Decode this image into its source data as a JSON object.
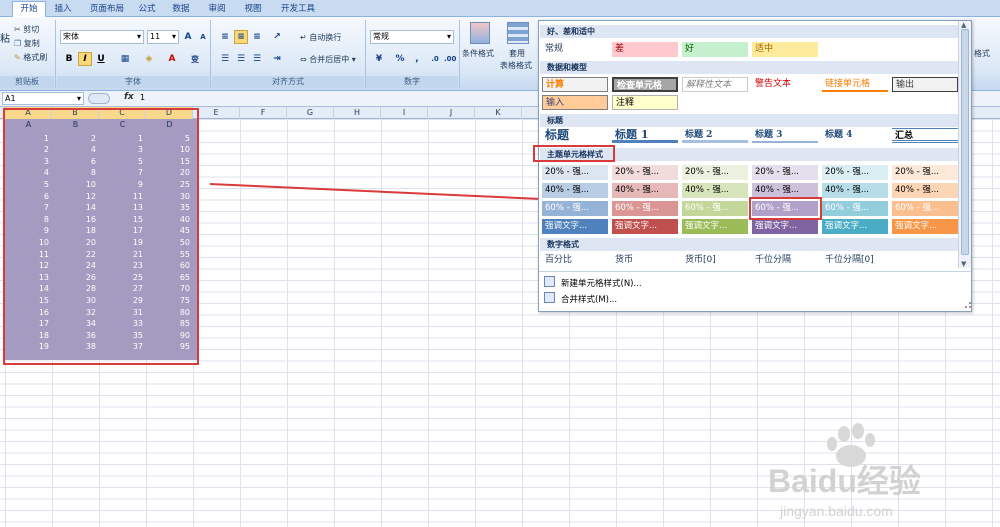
{
  "tabs": [
    "开始",
    "插入",
    "页面布局",
    "公式",
    "数据",
    "审阅",
    "视图",
    "开发工具"
  ],
  "clipboard": {
    "paste": "粘",
    "cut": "剪切",
    "copy": "复制",
    "format_painter": "格式刷",
    "label": "剪贴板"
  },
  "font": {
    "name": "宋体",
    "size": "11",
    "bold": "B",
    "italic": "I",
    "underline": "U",
    "label": "字体",
    "grow": "A",
    "shrink": "A",
    "char_a": "A",
    "wen": "变"
  },
  "alignment": {
    "wrap": "自动换行",
    "merge": "合并后居中",
    "label": "对齐方式"
  },
  "number": {
    "format": "常规",
    "percent": "%",
    "comma": ",",
    "label": "数字"
  },
  "styles": {
    "cond": "条件格式",
    "table": "套用",
    "table2": "表格格式"
  },
  "right_edge": {
    "label": "格式"
  },
  "formula_bar": {
    "cell_ref": "A1",
    "fx": "fx",
    "value": "1"
  },
  "columns": [
    "A",
    "B",
    "C",
    "D",
    "E",
    "F",
    "G",
    "H",
    "I",
    "J",
    "K"
  ],
  "table_rows": [
    [
      "1",
      "2",
      "1",
      "5"
    ],
    [
      "2",
      "4",
      "3",
      "10"
    ],
    [
      "3",
      "6",
      "5",
      "15"
    ],
    [
      "4",
      "8",
      "7",
      "20"
    ],
    [
      "5",
      "10",
      "9",
      "25"
    ],
    [
      "6",
      "12",
      "11",
      "30"
    ],
    [
      "7",
      "14",
      "13",
      "35"
    ],
    [
      "8",
      "16",
      "15",
      "40"
    ],
    [
      "9",
      "18",
      "17",
      "45"
    ],
    [
      "10",
      "20",
      "19",
      "50"
    ],
    [
      "11",
      "22",
      "21",
      "55"
    ],
    [
      "12",
      "24",
      "23",
      "60"
    ],
    [
      "13",
      "26",
      "25",
      "65"
    ],
    [
      "14",
      "28",
      "27",
      "70"
    ],
    [
      "15",
      "30",
      "29",
      "75"
    ],
    [
      "16",
      "32",
      "31",
      "80"
    ],
    [
      "17",
      "34",
      "33",
      "85"
    ],
    [
      "18",
      "36",
      "35",
      "90"
    ],
    [
      "19",
      "38",
      "37",
      "95"
    ]
  ],
  "panel": {
    "sec_good": "好、差和适中",
    "good_row": [
      "常规",
      "差",
      "好",
      "适中"
    ],
    "sec_data": "数据和模型",
    "data_row1": [
      "计算",
      "检查单元格",
      "解释性文本",
      "警告文本",
      "链接单元格",
      "输出"
    ],
    "data_row2": [
      "输入",
      "注释"
    ],
    "sec_title": "标题",
    "title_row": [
      "标题",
      "标题 1",
      "标题 2",
      "标题 3",
      "标题 4",
      "汇总"
    ],
    "sec_theme": "主题单元格样式",
    "theme_rows": [
      [
        "20% - 强...",
        "20% - 强...",
        "20% - 强...",
        "20% - 强...",
        "20% - 强...",
        "20% - 强..."
      ],
      [
        "40% - 强...",
        "40% - 强...",
        "40% - 强...",
        "40% - 强...",
        "40% - 强...",
        "40% - 强..."
      ],
      [
        "60% - 强...",
        "60% - 强...",
        "60% - 强...",
        "60% - 强...",
        "60% - 强...",
        "60% - 强..."
      ],
      [
        "强调文字...",
        "强调文字...",
        "强调文字...",
        "强调文字...",
        "强调文字...",
        "强调文字..."
      ]
    ],
    "sec_number": "数字格式",
    "number_row": [
      "百分比",
      "货币",
      "货币[0]",
      "千位分隔",
      "千位分隔[0]"
    ],
    "new_style": "新建单元格样式(N)...",
    "merge_style": "合并样式(M)..."
  },
  "watermark": {
    "text": "Baidu经验",
    "url": "jingyan.baidu.com"
  },
  "colors": {
    "selection": "#a59abf",
    "highlight": "#d93a3a"
  }
}
